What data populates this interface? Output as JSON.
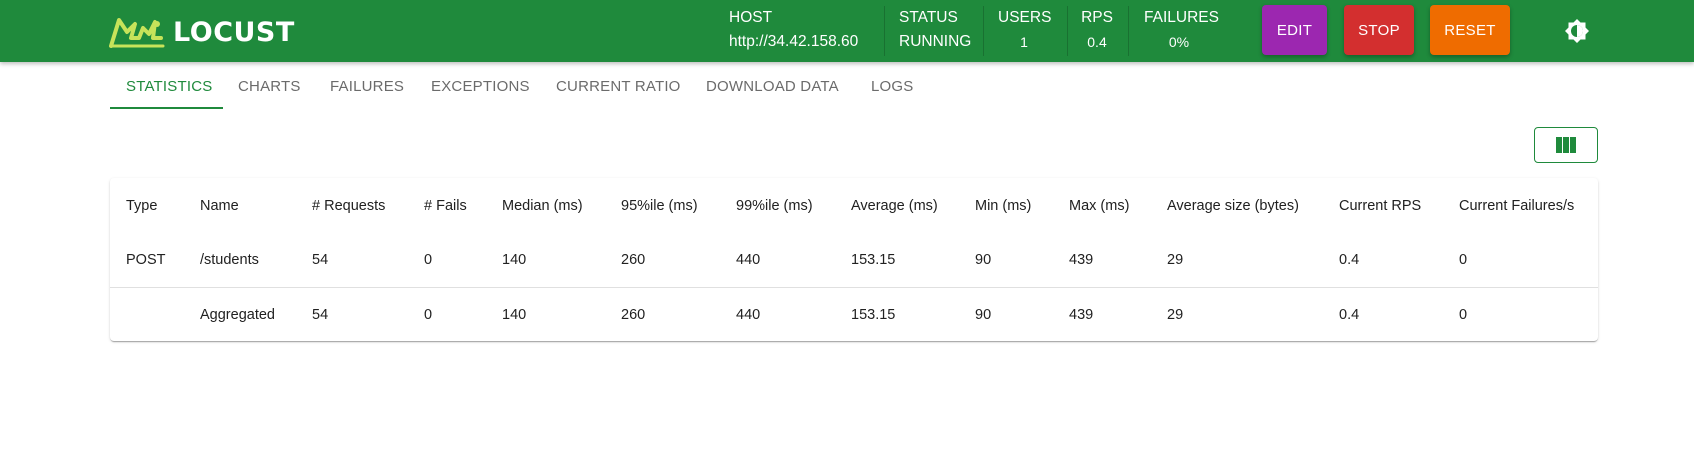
{
  "app": {
    "name": "LOCUST"
  },
  "header": {
    "host": {
      "label": "HOST",
      "value": "http://34.42.158.60"
    },
    "status": {
      "label": "STATUS",
      "value": "RUNNING"
    },
    "users": {
      "label": "USERS",
      "value": "1"
    },
    "rps": {
      "label": "RPS",
      "value": "0.4"
    },
    "failures": {
      "label": "FAILURES",
      "value": "0%"
    },
    "buttons": {
      "edit": "EDIT",
      "stop": "STOP",
      "reset": "RESET"
    },
    "brand_color": "#1f8a3c"
  },
  "tabs": [
    {
      "label": "STATISTICS",
      "active": true
    },
    {
      "label": "CHARTS",
      "active": false
    },
    {
      "label": "FAILURES",
      "active": false
    },
    {
      "label": "EXCEPTIONS",
      "active": false
    },
    {
      "label": "CURRENT RATIO",
      "active": false
    },
    {
      "label": "DOWNLOAD DATA",
      "active": false
    },
    {
      "label": "LOGS",
      "active": false
    }
  ],
  "table": {
    "columns": [
      "Type",
      "Name",
      "# Requests",
      "# Fails",
      "Median (ms)",
      "95%ile (ms)",
      "99%ile (ms)",
      "Average (ms)",
      "Min (ms)",
      "Max (ms)",
      "Average size (bytes)",
      "Current RPS",
      "Current Failures/s"
    ],
    "rows": [
      [
        "POST",
        "/students",
        "54",
        "0",
        "140",
        "260",
        "440",
        "153.15",
        "90",
        "439",
        "29",
        "0.4",
        "0"
      ],
      [
        "",
        "Aggregated",
        "54",
        "0",
        "140",
        "260",
        "440",
        "153.15",
        "90",
        "439",
        "29",
        "0.4",
        "0"
      ]
    ]
  },
  "icons": {
    "theme_toggle": "brightness-icon",
    "column_picker": "view-column-icon",
    "logo": "locust-logo-icon"
  }
}
